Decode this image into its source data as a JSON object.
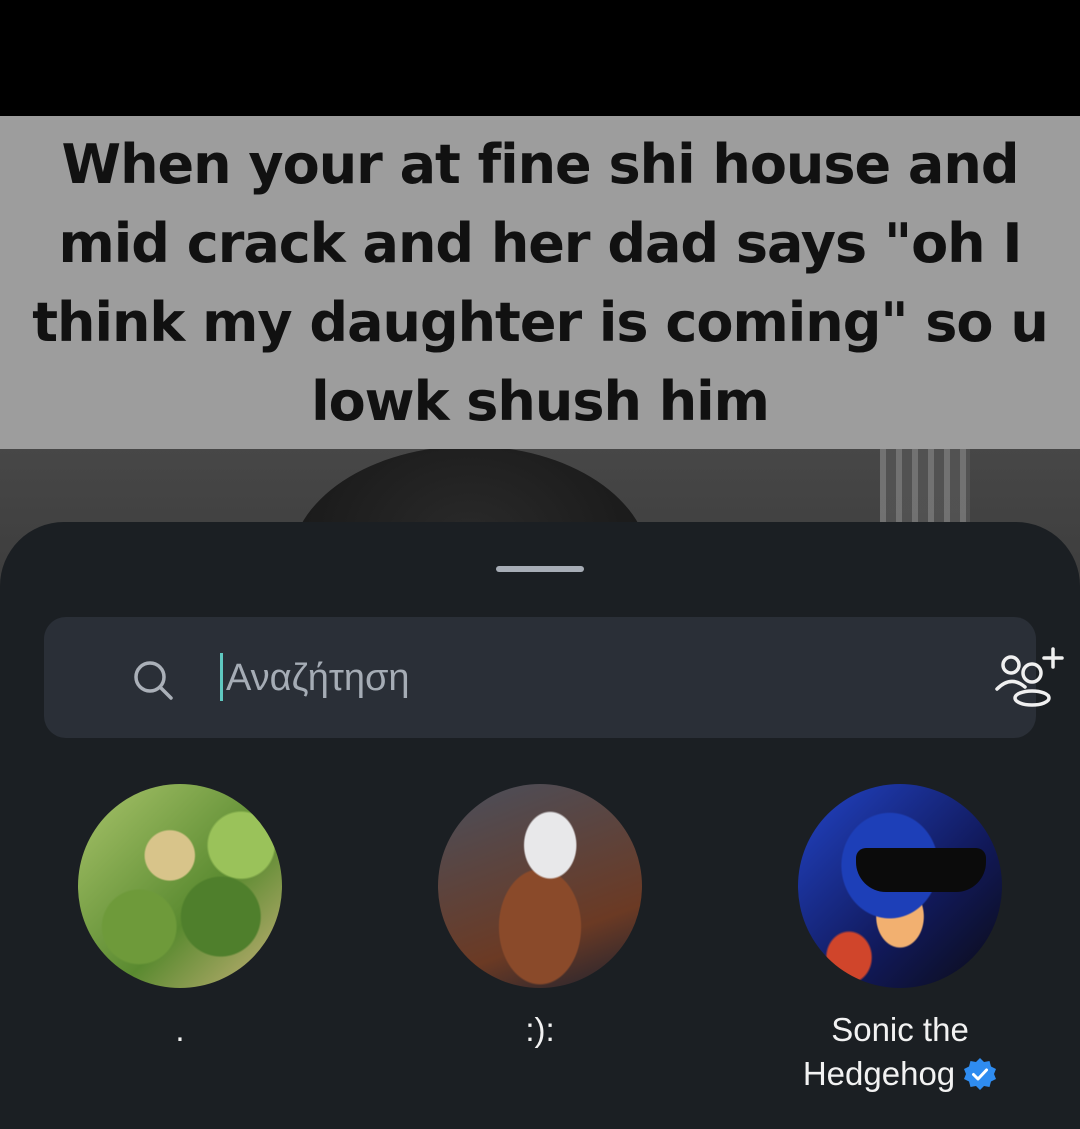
{
  "post": {
    "caption": "When your at fine shi house and mid crack and her dad says \"oh I think my daughter is coming\" so u lowk shush him"
  },
  "share_sheet": {
    "search": {
      "placeholder": "Αναζήτηση",
      "value": ""
    },
    "contacts": [
      {
        "name": ".",
        "verified": false
      },
      {
        "name": ":):",
        "verified": false
      },
      {
        "name": "Sonic the Hedgehog",
        "verified": true
      }
    ]
  },
  "colors": {
    "sheet_background": "#1b1f23",
    "search_background": "#2a2f37",
    "caret": "#5fc8c0",
    "verified_badge": "#2f8cf0"
  }
}
